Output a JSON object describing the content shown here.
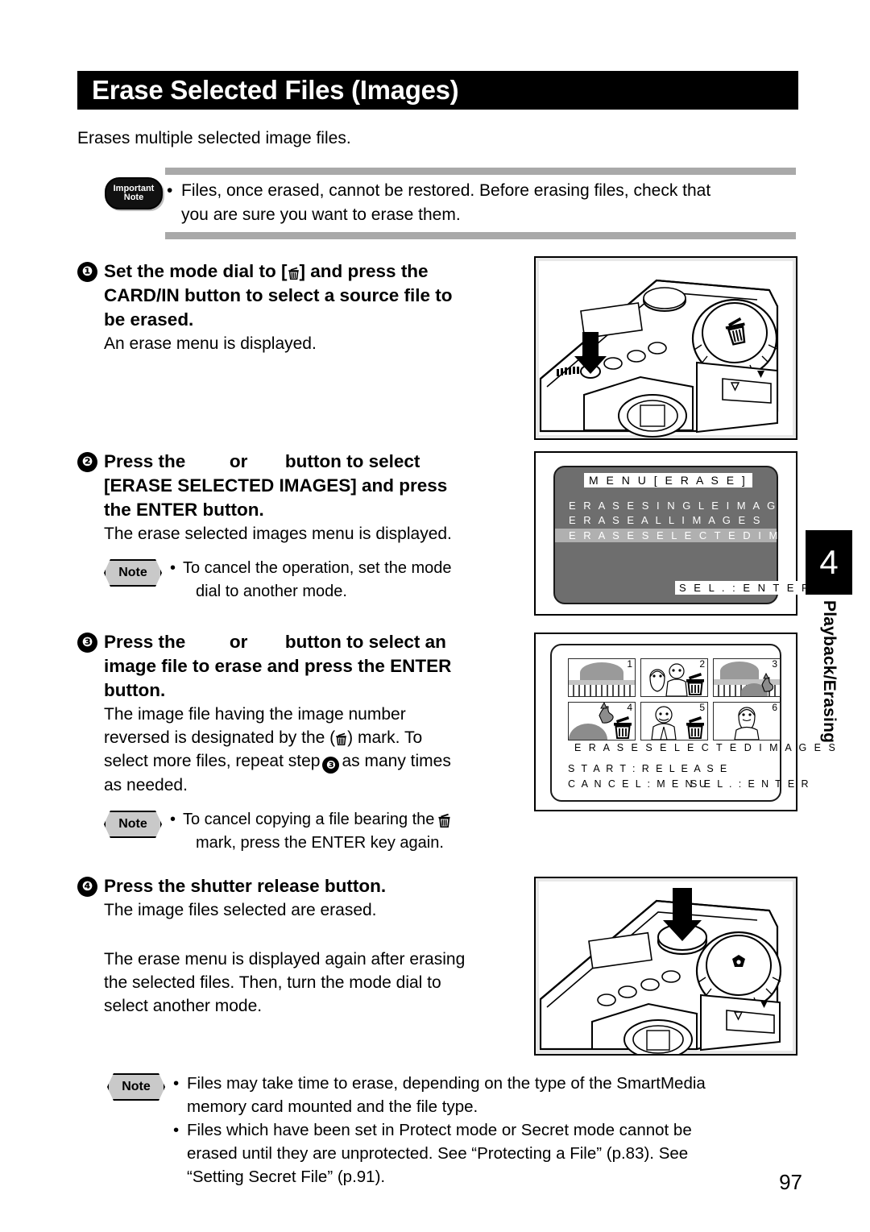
{
  "header": {
    "title": "Erase Selected Files (Images)"
  },
  "intro": "Erases multiple selected image files.",
  "important_note": {
    "badge_line1": "Important",
    "badge_line2": "Note",
    "bullet": "•",
    "line1": "Files, once erased, cannot be restored.  Before erasing files, check that",
    "line2": "you are sure you want to erase them."
  },
  "steps": [
    {
      "number": "❶",
      "heading_line1": "Set the mode dial to [",
      "heading_line1b": "] and press the",
      "heading_line2": "CARD/IN button to select a source file to",
      "heading_line3": "be erased.",
      "sub": "An erase menu is displayed."
    },
    {
      "number": "❷",
      "heading_line1a": "Press the",
      "heading_line1b": "or",
      "heading_line1c": "button to select",
      "heading_line2": "[ERASE SELECTED IMAGES] and press",
      "heading_line3": "the ENTER button.",
      "sub": "The erase selected images menu is displayed.",
      "note": {
        "badge": "Note",
        "bullet": "•",
        "line1": "To cancel the operation, set the mode",
        "line2": "dial to another mode."
      }
    },
    {
      "number": "❸",
      "heading_line1a": "Press the",
      "heading_line1b": "or",
      "heading_line1c": "button to select an",
      "heading_line2": "image file to erase and press the ENTER",
      "heading_line3": "button.",
      "sub_line1": "The image file having the image number",
      "sub_line2a": "reversed is designated by the (",
      "sub_line2b": ") mark.  To",
      "sub_line3a": "select more files, repeat step",
      "sub_line3b": "as many times",
      "sub_line4": "as needed.",
      "note": {
        "badge": "Note",
        "bullet": "•",
        "line1a": "To cancel copying a file bearing the",
        "line2": "mark, press the ENTER key again."
      }
    },
    {
      "number": "❹",
      "heading": "Press the shutter release button.",
      "sub": "The image files selected are erased.",
      "para_line1": "The erase menu is displayed again after erasing",
      "para_line2": "the selected files.  Then, turn the mode dial to",
      "para_line3": "select another mode."
    }
  ],
  "bottom_note": {
    "badge": "Note",
    "bullet": "•",
    "items": [
      {
        "line1": "Files may take time to erase, depending on the type of the SmartMedia",
        "line2": "memory card mounted and the file type."
      },
      {
        "line1": "Files which have been set in Protect mode or Secret mode cannot be",
        "line2": "erased until they are unprotected.  See “Protecting a File” (p.83). See",
        "line3": "“Setting Secret File” (p.91)."
      }
    ]
  },
  "figures": {
    "camera_top": {
      "caption": "camera top view with mode dial set to trash and arrow pressing CARD/IN button"
    },
    "camera_shutter": {
      "caption": "camera top view with arrow pressing shutter release button"
    },
    "erase_menu": {
      "title": "M E N U   [ E R A S E ]",
      "items": [
        "E R A S E   S I N G L E   I M A G E",
        "E R A S E   A L L   I M A G E S",
        "E R A S E   S E L E C T E D   I M A G E S"
      ],
      "selected_index": 2,
      "footer": "S E L . : E N T E R"
    },
    "thumbnail_screen": {
      "thumbs": [
        {
          "num": "1",
          "kind": "landscape",
          "marked": false
        },
        {
          "num": "2",
          "kind": "two-people",
          "marked": true
        },
        {
          "num": "3",
          "kind": "landscape-dog",
          "marked": false
        },
        {
          "num": "4",
          "kind": "dog",
          "marked": true
        },
        {
          "num": "5",
          "kind": "man",
          "marked": true
        },
        {
          "num": "6",
          "kind": "woman",
          "marked": false
        }
      ],
      "caption": "E R A S E   S E L E C T E D   I M A G E S",
      "footer_line1": "S T A R T  : R E L E A S E",
      "footer_line2a": "C A N C E L : M E N U",
      "footer_line2b": "S E L . : E N T E R"
    }
  },
  "chapter_tab": {
    "number": "4",
    "label": "Playback/Erasing"
  },
  "page_number": "97"
}
